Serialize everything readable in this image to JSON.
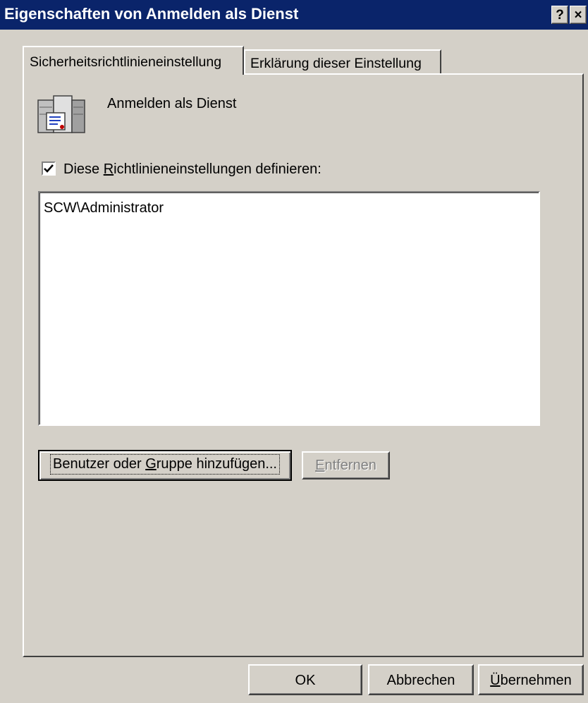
{
  "window": {
    "title": "Eigenschaften von Anmelden als Dienst",
    "help_label": "?",
    "close_label": "×"
  },
  "tabs": [
    {
      "label": "Sicherheitsrichtlinieneinstellung",
      "active": true
    },
    {
      "label": "Erklärung dieser Einstellung",
      "active": false
    }
  ],
  "policy": {
    "name": "Anmelden als Dienst",
    "icon": "server-policy-icon"
  },
  "define_checkbox": {
    "checked": true,
    "check_mark": "✓",
    "label_before": "Diese ",
    "label_accel": "R",
    "label_after": "ichtlinieneinstellungen definieren:"
  },
  "members": [
    "SCW\\Administrator"
  ],
  "buttons": {
    "add_before": "Benutzer oder ",
    "add_accel": "G",
    "add_after": "ruppe hinzufügen...",
    "remove_accel": "E",
    "remove_after": "ntfernen",
    "remove_enabled": false,
    "ok": "OK",
    "cancel": "Abbrechen",
    "apply_accel": "Ü",
    "apply_after": "bernehmen"
  },
  "colors": {
    "titlebar": "#0a246a",
    "face": "#d4d0c8",
    "disabled_text": "#808080"
  }
}
